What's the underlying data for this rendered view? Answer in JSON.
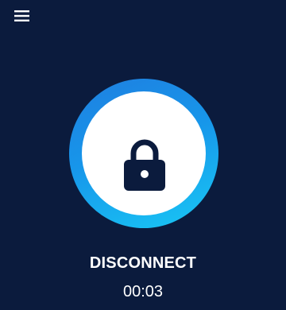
{
  "header": {
    "menu_icon": "hamburger-menu-icon"
  },
  "connection": {
    "state_icon": "lock-icon",
    "action_label": "DISCONNECT",
    "elapsed_time": "00:03"
  },
  "colors": {
    "background": "#0b1b3d",
    "ring_gradient_start": "#1f7fe0",
    "ring_gradient_end": "#19c8f5",
    "lock": "#0b1b3d",
    "text": "#ffffff"
  }
}
